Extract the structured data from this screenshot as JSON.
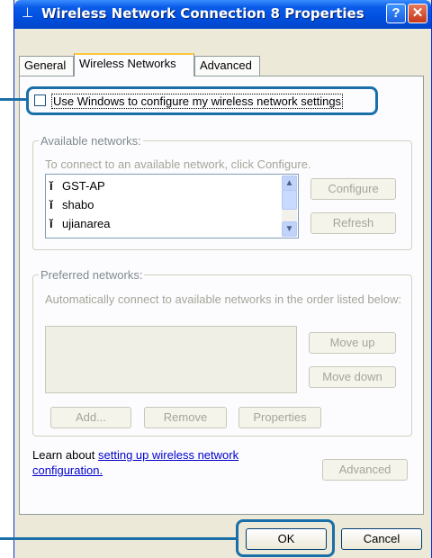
{
  "window": {
    "title": "Wireless Network Connection 8 Properties",
    "help_glyph": "?",
    "close_glyph": "✕"
  },
  "tabs": [
    {
      "label": "General"
    },
    {
      "label": "Wireless Networks"
    },
    {
      "label": "Advanced"
    }
  ],
  "use_windows_checkbox": {
    "label": "Use Windows to configure my wireless network settings",
    "checked": false
  },
  "available": {
    "legend": "Available networks:",
    "hint": "To connect to an available network, click Configure.",
    "networks": [
      "GST-AP",
      "shabo",
      "ujianarea"
    ],
    "configure_label": "Configure",
    "refresh_label": "Refresh"
  },
  "preferred": {
    "legend": "Preferred networks:",
    "hint": "Automatically connect to available networks in the order listed below:",
    "move_up_label": "Move up",
    "move_down_label": "Move down",
    "add_label": "Add...",
    "remove_label": "Remove",
    "properties_label": "Properties"
  },
  "learn": {
    "prefix": "Learn about ",
    "link": "setting up wireless network configuration.",
    "advanced_label": "Advanced"
  },
  "footer": {
    "ok_label": "OK",
    "cancel_label": "Cancel"
  },
  "colors": {
    "titlebar": "#0054e3",
    "callout": "#1b6fa8"
  }
}
